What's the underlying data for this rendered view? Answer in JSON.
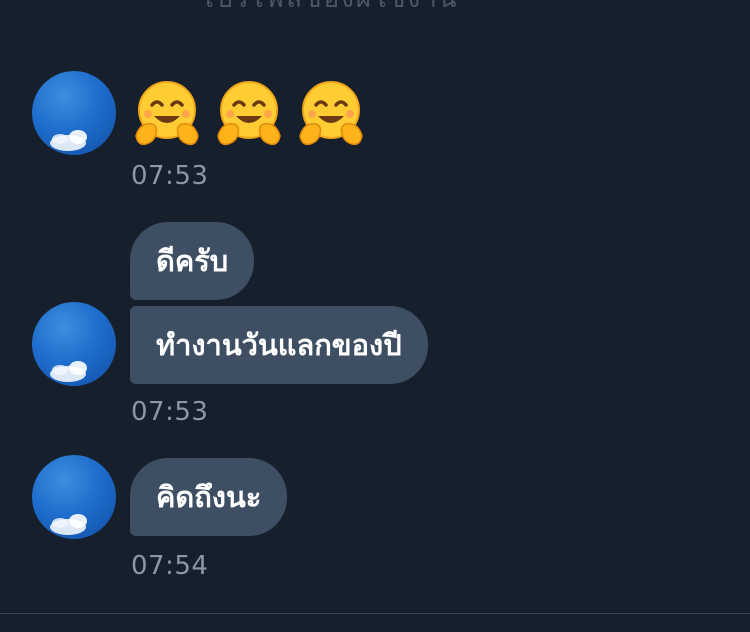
{
  "header": {
    "partial_text": "โปรไฟล์ของผู้ใช้งาน"
  },
  "messages": [
    {
      "type": "emoji",
      "emoji": [
        "🤗",
        "🤗",
        "🤗"
      ],
      "time": "07:53"
    },
    {
      "type": "text",
      "bubbles": [
        "ดีครับ",
        "ทำงานวันแลกของปี"
      ],
      "time": "07:53"
    },
    {
      "type": "text",
      "bubbles": [
        "คิดถึงนะ"
      ],
      "time": "07:54"
    }
  ],
  "avatar": {
    "icon": "sky-cloud-avatar"
  },
  "colors": {
    "background": "#161f2c",
    "bubble": "#3e4f63",
    "timestamp": "#8c97a6",
    "avatar_sky": "#1f6dcc"
  }
}
